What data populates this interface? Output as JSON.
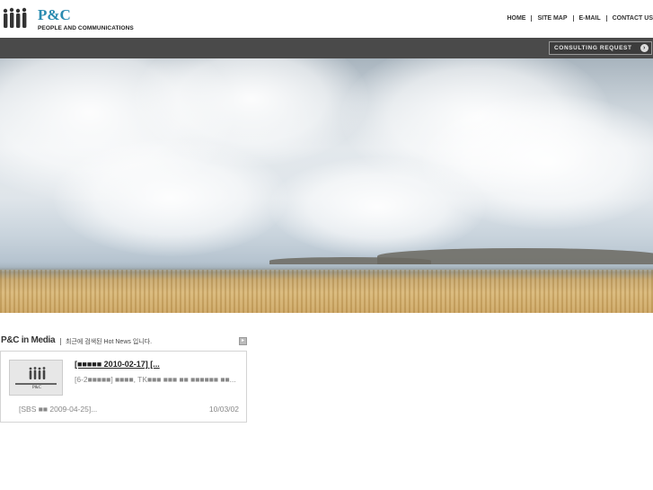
{
  "header": {
    "logo_text": "P&C",
    "logo_subtitle": "PEOPLE AND COMMUNICATIONS",
    "nav": [
      "HOME",
      "SITE MAP",
      "E-MAIL",
      "CONTACT US"
    ]
  },
  "bar": {
    "consulting_label": "CONSULTING REQUEST"
  },
  "media": {
    "title": "P&C in Media",
    "subtitle": "최근에 검색된 Hot News 입니다.",
    "news": {
      "title": "[■■■■■ 2010-02-17] [...",
      "desc": "[6-2■■■■■]  ■■■■, TK■■■ ■■■ ■■ ■■■■■■ ■■...",
      "sub": "[SBS ■■  2009-04-25]...",
      "date": "10/03/02"
    }
  },
  "colors": {
    "brand": "#2a8bb0",
    "bar": "#4a4a4a"
  }
}
